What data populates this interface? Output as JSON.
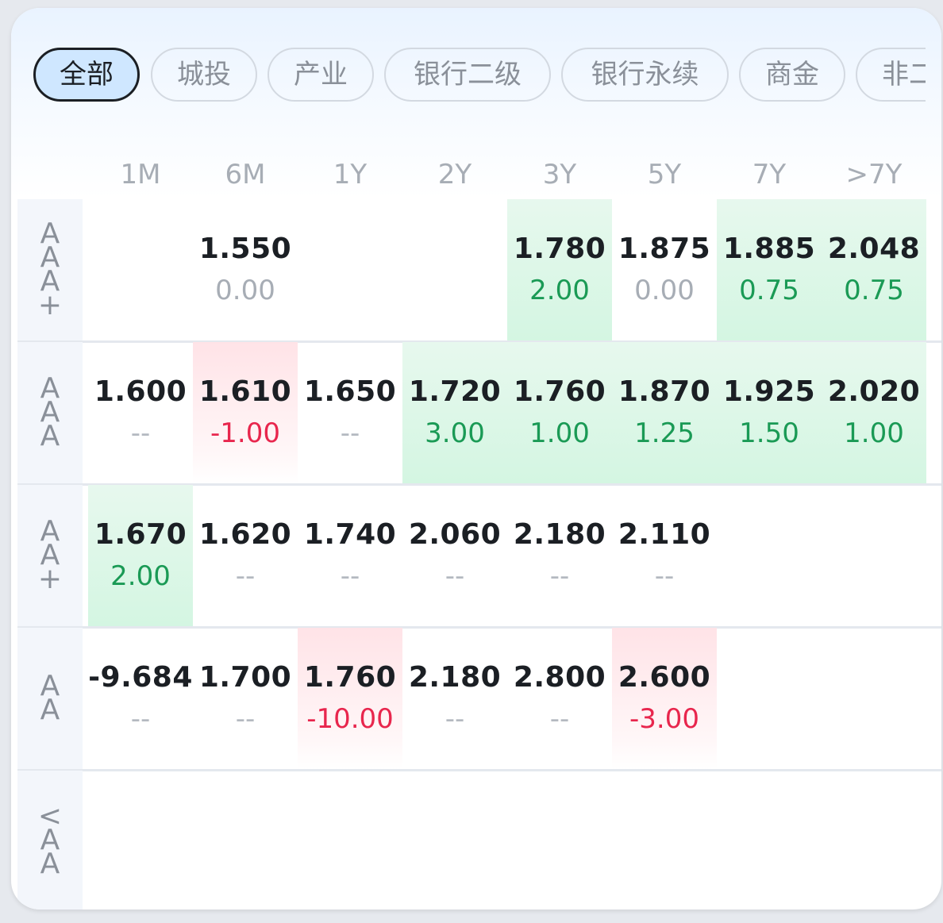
{
  "tabs": [
    {
      "label": "全部",
      "active": true
    },
    {
      "label": "城投",
      "active": false
    },
    {
      "label": "产业",
      "active": false
    },
    {
      "label": "银行二级",
      "active": false
    },
    {
      "label": "银行永续",
      "active": false
    },
    {
      "label": "商金",
      "active": false
    },
    {
      "label": "非二",
      "active": false
    }
  ],
  "columns": [
    "1M",
    "6M",
    "1Y",
    "2Y",
    "3Y",
    "5Y",
    "7Y",
    ">7Y"
  ],
  "rows": [
    {
      "label": [
        "A",
        "A",
        "A",
        "+"
      ],
      "cells": [
        null,
        {
          "value": "1.550",
          "change": "0.00",
          "trend": "zero"
        },
        null,
        null,
        {
          "value": "1.780",
          "change": "2.00",
          "trend": "up"
        },
        {
          "value": "1.875",
          "change": "0.00",
          "trend": "zero"
        },
        {
          "value": "1.885",
          "change": "0.75",
          "trend": "up"
        },
        {
          "value": "2.048",
          "change": "0.75",
          "trend": "up"
        }
      ]
    },
    {
      "label": [
        "A",
        "A",
        "A"
      ],
      "cells": [
        {
          "value": "1.600",
          "change": "--",
          "trend": "dash"
        },
        {
          "value": "1.610",
          "change": "-1.00",
          "trend": "down"
        },
        {
          "value": "1.650",
          "change": "--",
          "trend": "dash"
        },
        {
          "value": "1.720",
          "change": "3.00",
          "trend": "up"
        },
        {
          "value": "1.760",
          "change": "1.00",
          "trend": "up"
        },
        {
          "value": "1.870",
          "change": "1.25",
          "trend": "up"
        },
        {
          "value": "1.925",
          "change": "1.50",
          "trend": "up"
        },
        {
          "value": "2.020",
          "change": "1.00",
          "trend": "up"
        }
      ]
    },
    {
      "label": [
        "A",
        "A",
        "+"
      ],
      "cells": [
        {
          "value": "1.670",
          "change": "2.00",
          "trend": "up"
        },
        {
          "value": "1.620",
          "change": "--",
          "trend": "dash"
        },
        {
          "value": "1.740",
          "change": "--",
          "trend": "dash"
        },
        {
          "value": "2.060",
          "change": "--",
          "trend": "dash"
        },
        {
          "value": "2.180",
          "change": "--",
          "trend": "dash"
        },
        {
          "value": "2.110",
          "change": "--",
          "trend": "dash"
        },
        null,
        null
      ]
    },
    {
      "label": [
        "A",
        "A"
      ],
      "cells": [
        {
          "value": "-9.684",
          "change": "--",
          "trend": "dash"
        },
        {
          "value": "1.700",
          "change": "--",
          "trend": "dash"
        },
        {
          "value": "1.760",
          "change": "-10.00",
          "trend": "down"
        },
        {
          "value": "2.180",
          "change": "--",
          "trend": "dash"
        },
        {
          "value": "2.800",
          "change": "--",
          "trend": "dash"
        },
        {
          "value": "2.600",
          "change": "-3.00",
          "trend": "down"
        },
        null,
        null
      ]
    },
    {
      "label": [
        "<",
        "A",
        "A"
      ],
      "cells": [
        null,
        null,
        null,
        null,
        null,
        null,
        null,
        null
      ]
    }
  ],
  "colors": {
    "up_text": "#1a9a55",
    "down_text": "#e8264d",
    "active_tab_bg": "#cfe7ff"
  }
}
